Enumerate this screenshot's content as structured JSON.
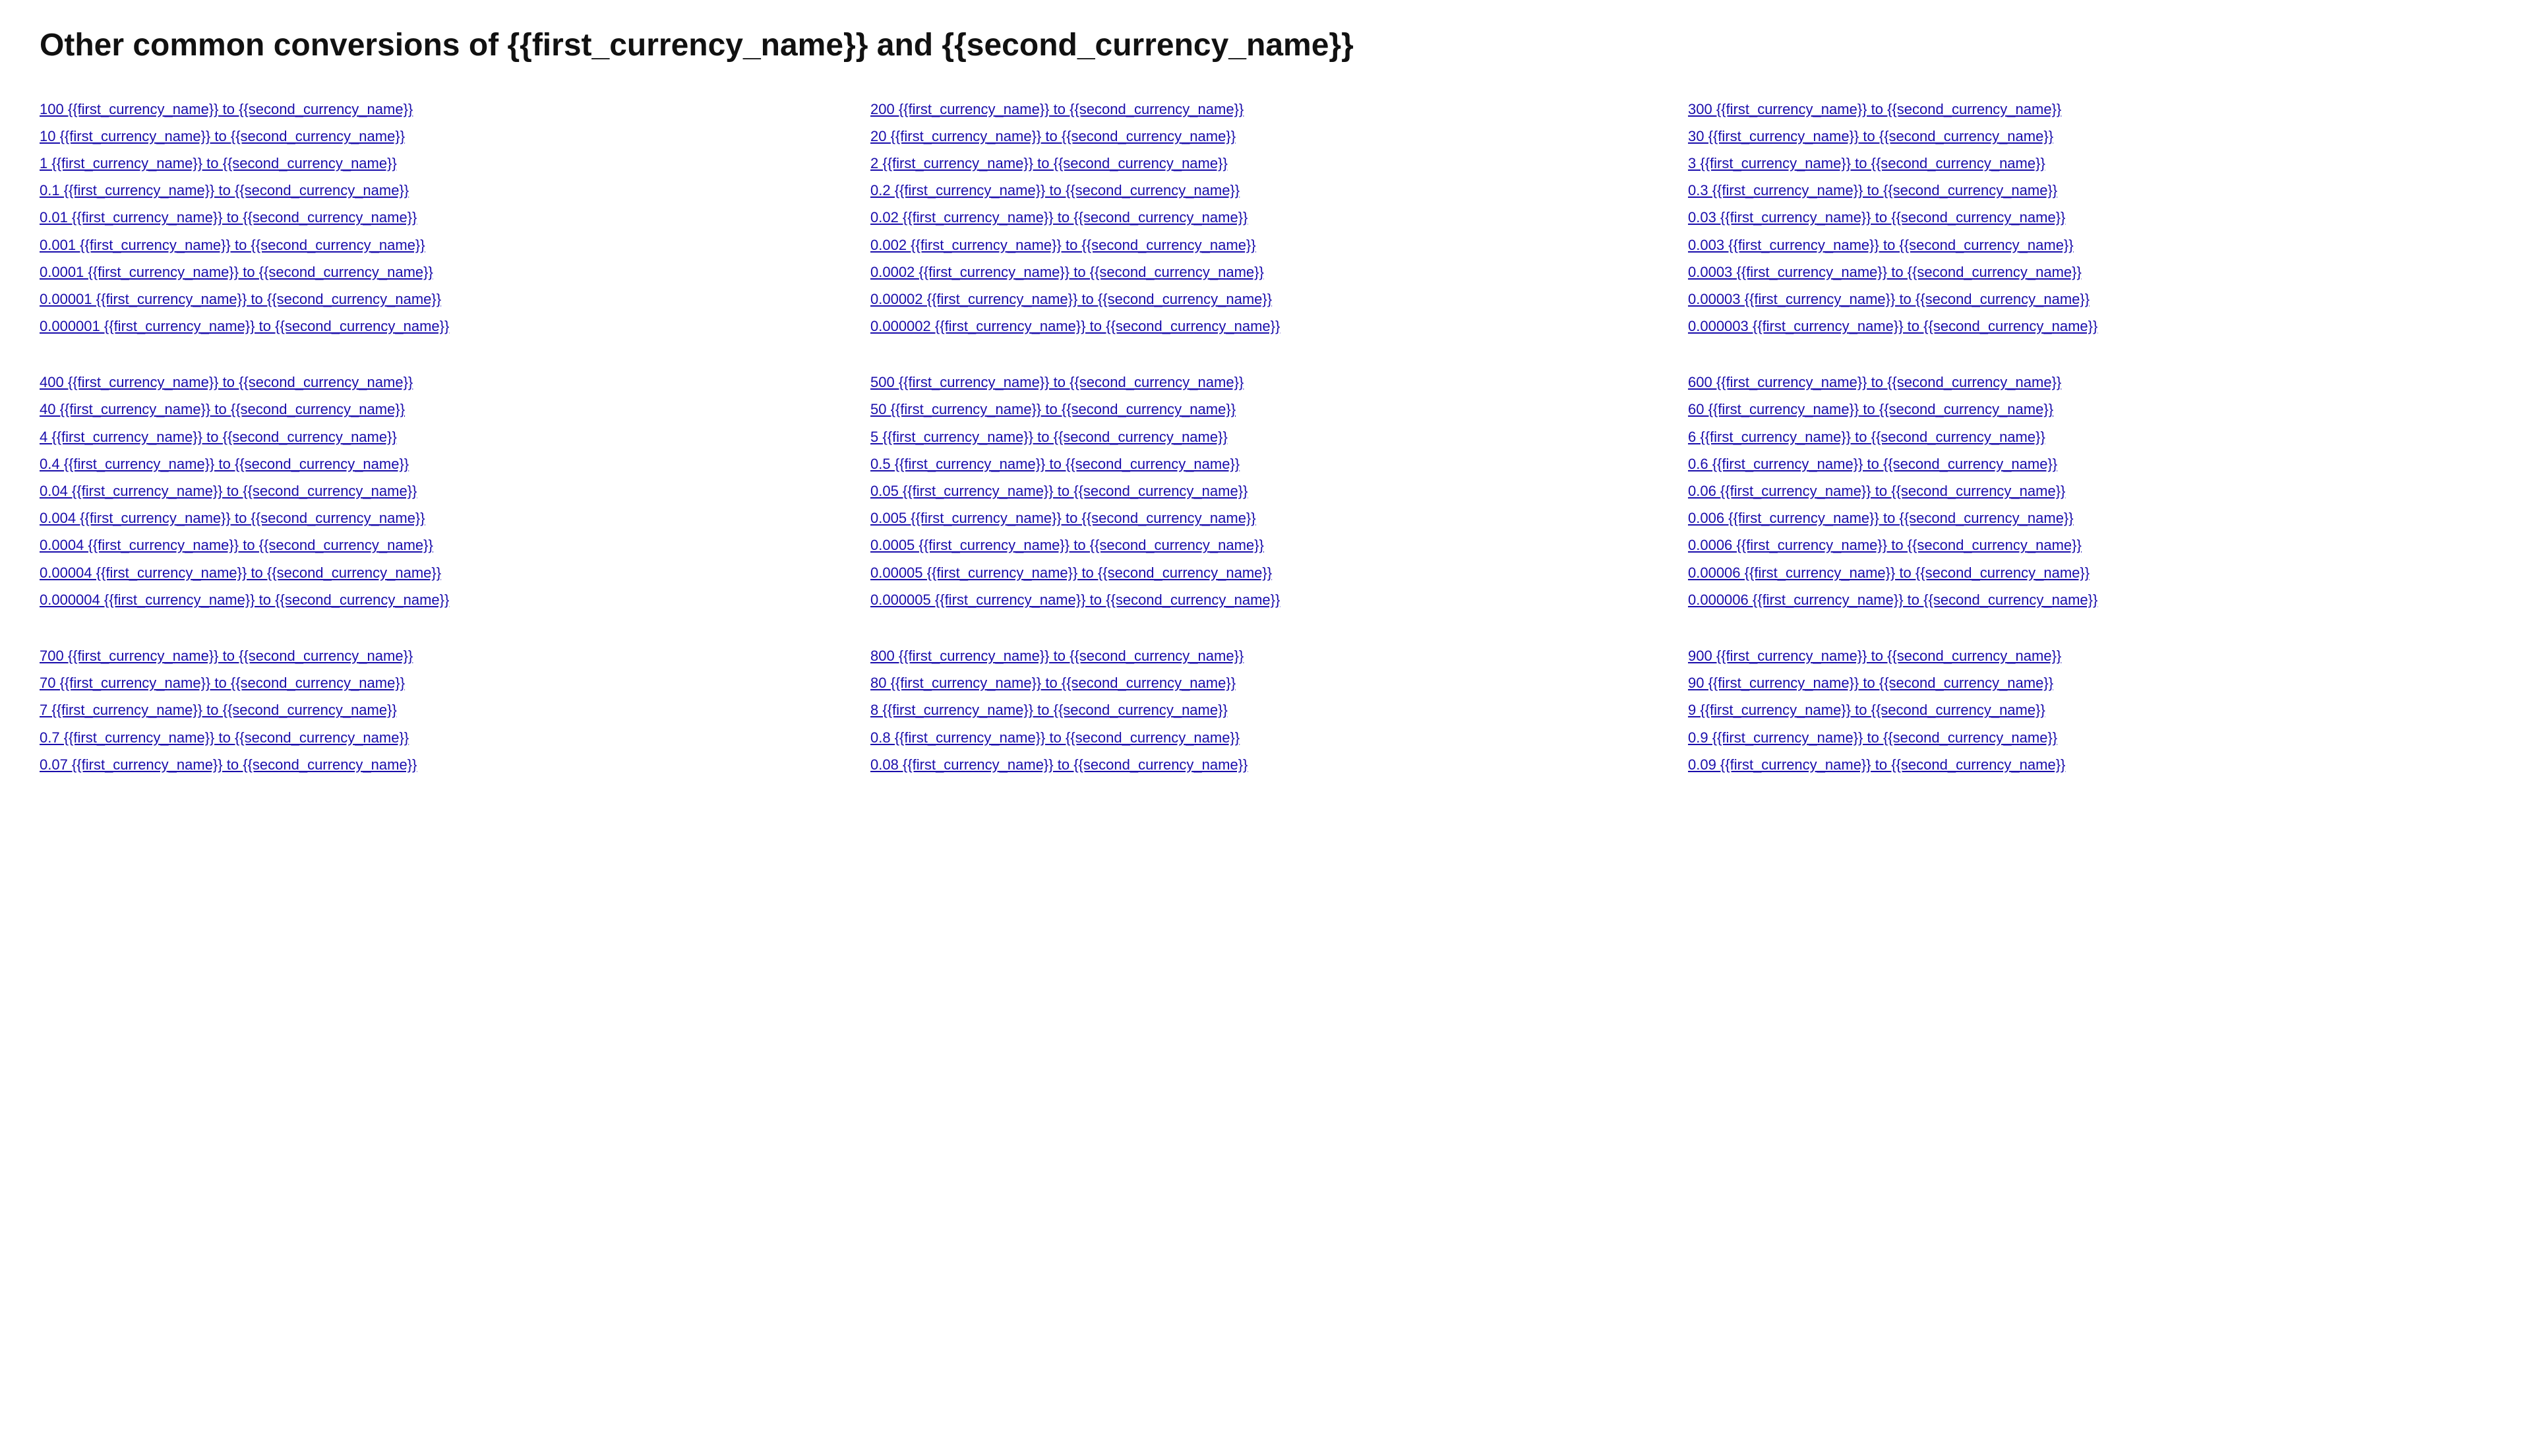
{
  "page": {
    "title": "Other common conversions of {{first_currency_name}} and {{second_currency_name}}"
  },
  "columns": [
    {
      "id": "col1",
      "groups": [
        {
          "id": "g1",
          "links": [
            "100 {{first_currency_name}} to {{second_currency_name}}",
            "10 {{first_currency_name}} to {{second_currency_name}}",
            "1 {{first_currency_name}} to {{second_currency_name}}",
            "0.1 {{first_currency_name}} to {{second_currency_name}}",
            "0.01 {{first_currency_name}} to {{second_currency_name}}",
            "0.001 {{first_currency_name}} to {{second_currency_name}}",
            "0.0001 {{first_currency_name}} to {{second_currency_name}}",
            "0.00001 {{first_currency_name}} to {{second_currency_name}}",
            "0.000001 {{first_currency_name}} to {{second_currency_name}}"
          ]
        },
        {
          "id": "g4",
          "links": [
            "400 {{first_currency_name}} to {{second_currency_name}}",
            "40 {{first_currency_name}} to {{second_currency_name}}",
            "4 {{first_currency_name}} to {{second_currency_name}}",
            "0.4 {{first_currency_name}} to {{second_currency_name}}",
            "0.04 {{first_currency_name}} to {{second_currency_name}}",
            "0.004 {{first_currency_name}} to {{second_currency_name}}",
            "0.0004 {{first_currency_name}} to {{second_currency_name}}",
            "0.00004 {{first_currency_name}} to {{second_currency_name}}",
            "0.000004 {{first_currency_name}} to {{second_currency_name}}"
          ]
        },
        {
          "id": "g7",
          "links": [
            "700 {{first_currency_name}} to {{second_currency_name}}",
            "70 {{first_currency_name}} to {{second_currency_name}}",
            "7 {{first_currency_name}} to {{second_currency_name}}",
            "0.7 {{first_currency_name}} to {{second_currency_name}}",
            "0.07 {{first_currency_name}} to {{second_currency_name}}"
          ]
        }
      ]
    },
    {
      "id": "col2",
      "groups": [
        {
          "id": "g2",
          "links": [
            "200 {{first_currency_name}} to {{second_currency_name}}",
            "20 {{first_currency_name}} to {{second_currency_name}}",
            "2 {{first_currency_name}} to {{second_currency_name}}",
            "0.2 {{first_currency_name}} to {{second_currency_name}}",
            "0.02 {{first_currency_name}} to {{second_currency_name}}",
            "0.002 {{first_currency_name}} to {{second_currency_name}}",
            "0.0002 {{first_currency_name}} to {{second_currency_name}}",
            "0.00002 {{first_currency_name}} to {{second_currency_name}}",
            "0.000002 {{first_currency_name}} to {{second_currency_name}}"
          ]
        },
        {
          "id": "g5",
          "links": [
            "500 {{first_currency_name}} to {{second_currency_name}}",
            "50 {{first_currency_name}} to {{second_currency_name}}",
            "5 {{first_currency_name}} to {{second_currency_name}}",
            "0.5 {{first_currency_name}} to {{second_currency_name}}",
            "0.05 {{first_currency_name}} to {{second_currency_name}}",
            "0.005 {{first_currency_name}} to {{second_currency_name}}",
            "0.0005 {{first_currency_name}} to {{second_currency_name}}",
            "0.00005 {{first_currency_name}} to {{second_currency_name}}",
            "0.000005 {{first_currency_name}} to {{second_currency_name}}"
          ]
        },
        {
          "id": "g8",
          "links": [
            "800 {{first_currency_name}} to {{second_currency_name}}",
            "80 {{first_currency_name}} to {{second_currency_name}}",
            "8 {{first_currency_name}} to {{second_currency_name}}",
            "0.8 {{first_currency_name}} to {{second_currency_name}}",
            "0.08 {{first_currency_name}} to {{second_currency_name}}"
          ]
        }
      ]
    },
    {
      "id": "col3",
      "groups": [
        {
          "id": "g3",
          "links": [
            "300 {{first_currency_name}} to {{second_currency_name}}",
            "30 {{first_currency_name}} to {{second_currency_name}}",
            "3 {{first_currency_name}} to {{second_currency_name}}",
            "0.3 {{first_currency_name}} to {{second_currency_name}}",
            "0.03 {{first_currency_name}} to {{second_currency_name}}",
            "0.003 {{first_currency_name}} to {{second_currency_name}}",
            "0.0003 {{first_currency_name}} to {{second_currency_name}}",
            "0.00003 {{first_currency_name}} to {{second_currency_name}}",
            "0.000003 {{first_currency_name}} to {{second_currency_name}}"
          ]
        },
        {
          "id": "g6",
          "links": [
            "600 {{first_currency_name}} to {{second_currency_name}}",
            "60 {{first_currency_name}} to {{second_currency_name}}",
            "6 {{first_currency_name}} to {{second_currency_name}}",
            "0.6 {{first_currency_name}} to {{second_currency_name}}",
            "0.06 {{first_currency_name}} to {{second_currency_name}}",
            "0.006 {{first_currency_name}} to {{second_currency_name}}",
            "0.0006 {{first_currency_name}} to {{second_currency_name}}",
            "0.00006 {{first_currency_name}} to {{second_currency_name}}",
            "0.000006 {{first_currency_name}} to {{second_currency_name}}"
          ]
        },
        {
          "id": "g9",
          "links": [
            "900 {{first_currency_name}} to {{second_currency_name}}",
            "90 {{first_currency_name}} to {{second_currency_name}}",
            "9 {{first_currency_name}} to {{second_currency_name}}",
            "0.9 {{first_currency_name}} to {{second_currency_name}}",
            "0.09 {{first_currency_name}} to {{second_currency_name}}"
          ]
        }
      ]
    }
  ]
}
